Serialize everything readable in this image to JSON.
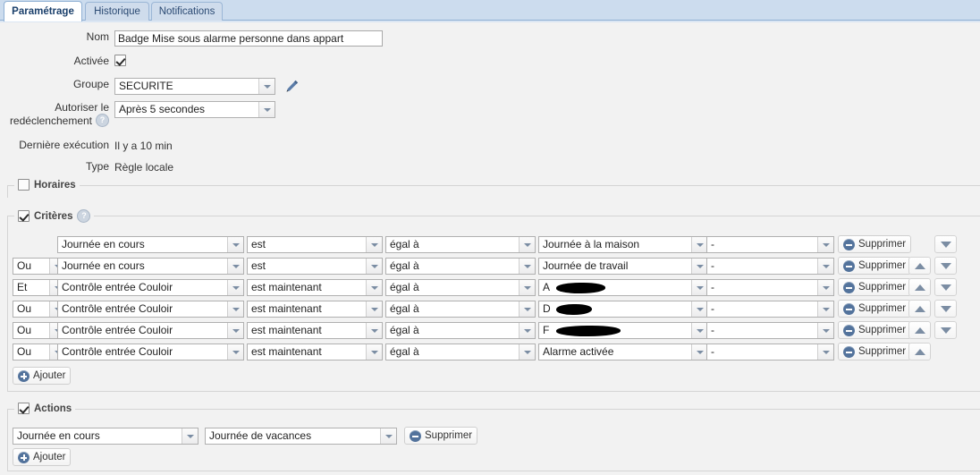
{
  "tabs": [
    {
      "label": "Paramétrage",
      "active": true
    },
    {
      "label": "Historique",
      "active": false
    },
    {
      "label": "Notifications",
      "active": false
    }
  ],
  "form": {
    "nom_label": "Nom",
    "nom_value": "Badge Mise sous alarme personne dans appart",
    "activee_label": "Activée",
    "activee_checked": true,
    "groupe_label": "Groupe",
    "groupe_value": "SECURITE",
    "edit_icon": "pencil-icon",
    "retrigger_label_line1": "Autoriser le",
    "retrigger_label_line2": "redéclenchement",
    "retrigger_value": "Après 5 secondes",
    "help_icon": "help-icon",
    "last_exec_label": "Dernière exécution",
    "last_exec_value": "Il y a 10 min",
    "type_label": "Type",
    "type_value": "Règle locale"
  },
  "horaires": {
    "legend": "Horaires",
    "checked": false
  },
  "criteres": {
    "legend": "Critères",
    "checked": true,
    "help_icon": "help-icon",
    "add_label": "Ajouter",
    "delete_label": "Supprimer",
    "rows": [
      {
        "logic": "",
        "subject": "Journée en cours",
        "operator": "est",
        "comparator": "égal à",
        "value": "Journée à la maison",
        "extra": "-",
        "redacted": false,
        "up": false,
        "down": true
      },
      {
        "logic": "Ou",
        "subject": "Journée en cours",
        "operator": "est",
        "comparator": "égal à",
        "value": "Journée de travail",
        "extra": "-",
        "redacted": false,
        "up": true,
        "down": true
      },
      {
        "logic": "Et",
        "subject": "Contrôle entrée Couloir",
        "operator": "est maintenant",
        "comparator": "égal à",
        "value": "A",
        "extra": "-",
        "redacted": true,
        "up": true,
        "down": true
      },
      {
        "logic": "Ou",
        "subject": "Contrôle entrée Couloir",
        "operator": "est maintenant",
        "comparator": "égal à",
        "value": "D",
        "extra": "-",
        "redacted": true,
        "up": true,
        "down": true
      },
      {
        "logic": "Ou",
        "subject": "Contrôle entrée Couloir",
        "operator": "est maintenant",
        "comparator": "égal à",
        "value": "F",
        "extra": "-",
        "redacted": true,
        "up": true,
        "down": true
      },
      {
        "logic": "Ou",
        "subject": "Contrôle entrée Couloir",
        "operator": "est maintenant",
        "comparator": "égal à",
        "value": "Alarme activée",
        "extra": "-",
        "redacted": false,
        "up": true,
        "down": false
      }
    ]
  },
  "actions": {
    "legend": "Actions",
    "checked": true,
    "add_label": "Ajouter",
    "delete_label": "Supprimer",
    "rows": [
      {
        "target": "Journée en cours",
        "value": "Journée de vacances"
      }
    ]
  }
}
